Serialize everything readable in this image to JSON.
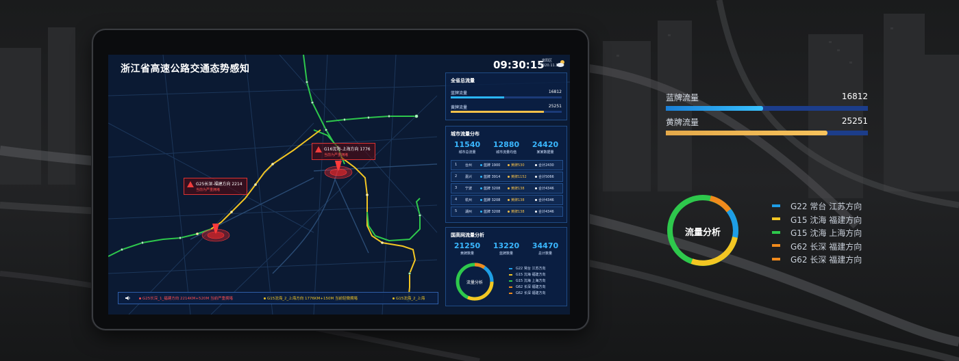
{
  "screen": {
    "title": "浙江省高速公路交通态势感知",
    "clock": "09:30:15",
    "city": "富阳区",
    "date": "2020.11.11"
  },
  "alerts": [
    {
      "line1": "G16沈海-上海方向 1776",
      "line2": "当前为严重拥堵"
    },
    {
      "line1": "G25长深-福建方向 2214",
      "line2": "当前为严重拥堵"
    }
  ],
  "total_flow": {
    "title": "全省总流量",
    "blue_label": "蓝牌流量",
    "blue_value": "16812",
    "blue_fraction": 0.48,
    "yellow_label": "黄牌流量",
    "yellow_value": "25251",
    "yellow_fraction": 0.84
  },
  "city_flow": {
    "title": "城市流量分布",
    "stats": [
      {
        "value": "11540",
        "label": "城市总流量"
      },
      {
        "value": "12880",
        "label": "城市流量均值"
      },
      {
        "value": "24420",
        "label": "某某数据量"
      }
    ],
    "rows": [
      {
        "rank": "1",
        "city": "台州",
        "blue": "蓝牌 1900",
        "yellow": "黄牌530",
        "total": "合计2430"
      },
      {
        "rank": "2",
        "city": "嘉兴",
        "blue": "蓝牌 3914",
        "yellow": "黄牌1152",
        "total": "合计5066"
      },
      {
        "rank": "3",
        "city": "宁波",
        "blue": "蓝牌 3208",
        "yellow": "黄牌138",
        "total": "合计4346"
      },
      {
        "rank": "4",
        "city": "杭州",
        "blue": "蓝牌 3208",
        "yellow": "黄牌138",
        "total": "合计4346"
      },
      {
        "rank": "5",
        "city": "湖州",
        "blue": "蓝牌 3208",
        "yellow": "黄牌138",
        "total": "合计4346"
      }
    ]
  },
  "national": {
    "title": "国高网流量分析",
    "stats": [
      {
        "value": "21250",
        "label": "黄牌数量"
      },
      {
        "value": "13220",
        "label": "蓝牌数量"
      },
      {
        "value": "34470",
        "label": "总计数量"
      }
    ],
    "donut_label": "流量分析",
    "legend": [
      {
        "road": "G22",
        "city": "常台",
        "dir": "江苏方向",
        "color": "#1e9de6"
      },
      {
        "road": "G15",
        "city": "沈海",
        "dir": "福建方向",
        "color": "#f3c623"
      },
      {
        "road": "G15",
        "city": "沈海",
        "dir": "上海方向",
        "color": "#2ec84c"
      },
      {
        "road": "G62",
        "city": "长深",
        "dir": "福建方向",
        "color": "#f08a1c"
      },
      {
        "road": "G62",
        "city": "长深",
        "dir": "福建方向",
        "color": "#f08a1c"
      }
    ]
  },
  "ticker": [
    {
      "text": "G25长深_1_福建方向 2214KM+520M 当前严重拥堵",
      "color": "#ff4d4f"
    },
    {
      "text": "G15沈海_2_上海方向 1776KM+150M 当前轻微拥堵",
      "color": "#f3c623"
    },
    {
      "text": "G15沈海_2_上海",
      "color": "#f3c623"
    }
  ],
  "big": {
    "blue_label": "蓝牌流量",
    "blue_value": "16812",
    "blue_fraction": 0.48,
    "yellow_label": "黄牌流量",
    "yellow_value": "25251",
    "yellow_fraction": 0.8,
    "donut_label": "流量分析",
    "legend": [
      {
        "text": "G22  常台  江苏方向",
        "color": "#1e9de6"
      },
      {
        "text": "G15  沈海  福建方向",
        "color": "#f3c623"
      },
      {
        "text": "G15  沈海  上海方向",
        "color": "#2ec84c"
      },
      {
        "text": "G62  长深  福建方向",
        "color": "#f08a1c"
      },
      {
        "text": "G62  长深  福建方向",
        "color": "#f08a1c"
      }
    ]
  },
  "colors": {
    "blue": "#2bb7ff",
    "yellow": "#f5c04a",
    "green": "#2ec84c",
    "orange": "#f08a1c",
    "alarm": "#ff3b3b"
  }
}
